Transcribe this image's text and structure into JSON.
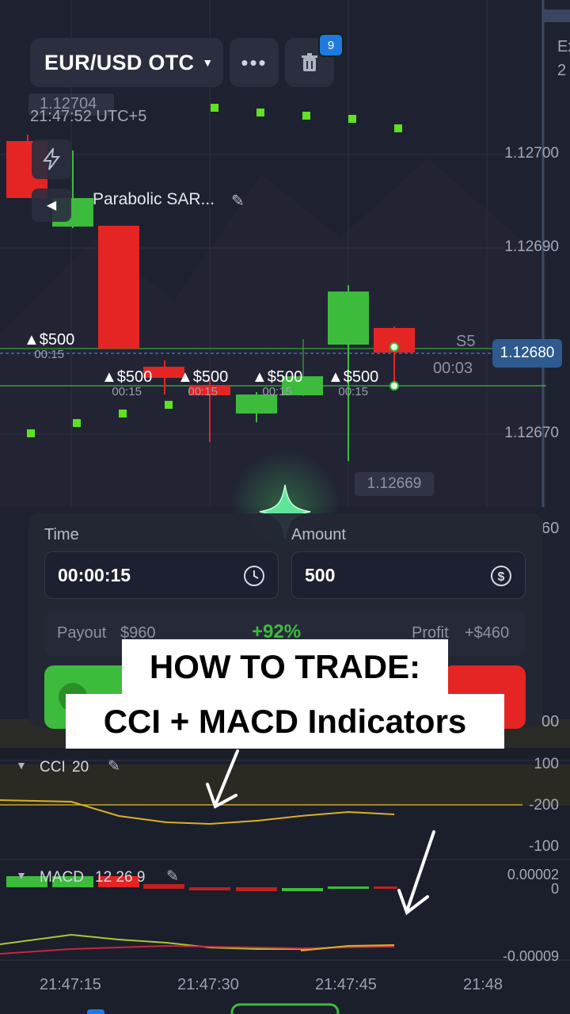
{
  "header": {
    "pair": "EUR/USD OTC",
    "more_icon": "ellipsis-icon",
    "trash_icon": "trash-icon",
    "badge_count": "9",
    "right_text_1": "Ex",
    "right_text_2": "2"
  },
  "chart": {
    "top_price": "1.12704",
    "clock": "21:47:52 UTC+5",
    "indicator_name": "Parabolic SAR...",
    "price_labels": [
      "1.12700",
      "1.12690",
      "1.12680",
      "1.12670"
    ],
    "current_price": "1.12680",
    "low_price": "1.12669",
    "countdown": "00:03",
    "s5_label": "S5",
    "side_label": "60",
    "colors": {
      "bull": "#3dbb3d",
      "bear": "#e52424",
      "sar": "#5fe21f"
    }
  },
  "trades": [
    {
      "amount": "$500",
      "time": "00:15"
    },
    {
      "amount": "$500",
      "time": "00:15"
    },
    {
      "amount": "$500",
      "time": "00:15"
    },
    {
      "amount": "$500",
      "time": "00:15"
    },
    {
      "amount": "$500",
      "time": "00:15"
    }
  ],
  "panel": {
    "time_label": "Time",
    "time_value": "00:00:15",
    "amount_label": "Amount",
    "amount_value": "500",
    "payout_label": "Payout",
    "payout_value": "$960",
    "percent": "+92%",
    "profit_label": "Profit",
    "profit_value": "+$460",
    "side_num": "00"
  },
  "caption": {
    "line1": "HOW TO TRADE:",
    "line2": "CCI + MACD Indicators"
  },
  "cci": {
    "label": "CCI",
    "period": "20",
    "levels": [
      "100",
      "-200",
      "-100"
    ]
  },
  "macd": {
    "label": "MACD",
    "params": "12 26 9",
    "levels": [
      "0.00002",
      "0",
      "-0.00009"
    ]
  },
  "time_axis": [
    "21:47:15",
    "21:47:30",
    "21:47:45",
    "21:48"
  ]
}
